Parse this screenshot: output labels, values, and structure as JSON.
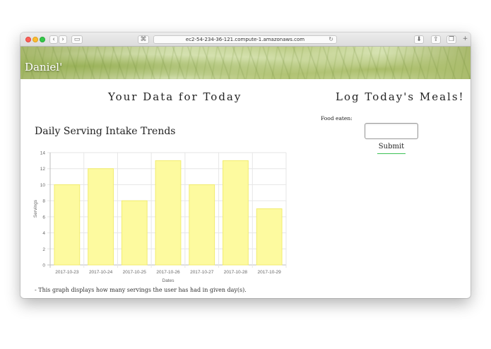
{
  "browser": {
    "url": "ec2-54-234-36-121.compute-1.amazonaws.com"
  },
  "header": {
    "brand": "Daniel'"
  },
  "main": {
    "left_title": "Your Data for Today",
    "right_title": "Log Today's Meals!",
    "chart_heading": "Daily Serving Intake Trends",
    "chart_note": "- This graph displays how many servings the user has had in given day(s).",
    "form": {
      "food_label": "Food eaten:",
      "food_value": "",
      "submit_label": "Submit"
    }
  },
  "colors": {
    "bar_fill": "#fdfa9f",
    "bar_stroke": "#f2ec6f",
    "submit_underline": "#3cc256"
  },
  "chart_data": {
    "type": "bar",
    "categories": [
      "2017-10-23",
      "2017-10-24",
      "2017-10-25",
      "2017-10-26",
      "2017-10-27",
      "2017-10-28",
      "2017-10-29"
    ],
    "values": [
      10,
      12,
      8,
      13,
      10,
      13,
      7
    ],
    "xlabel": "Dates",
    "ylabel": "Servings",
    "ylim": [
      0,
      14
    ],
    "yticks": [
      0,
      2,
      4,
      6,
      8,
      10,
      12,
      14
    ],
    "grid": true,
    "legend": "none"
  }
}
